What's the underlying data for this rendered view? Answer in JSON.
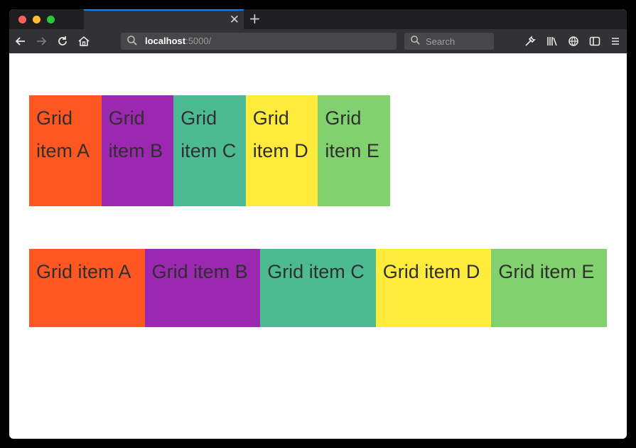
{
  "browser": {
    "tab_close_glyph": "✕",
    "new_tab_glyph": "+",
    "url_host": "localhost",
    "url_rest": ":5000/",
    "search_placeholder": "Search"
  },
  "icons": [
    "back-icon",
    "forward-icon",
    "reload-icon",
    "home-icon",
    "search-icon",
    "wrench-icon",
    "library-icon",
    "tracking-protection-icon",
    "sidebar-icon",
    "menu-icon"
  ],
  "colors": {
    "a": "#ff5722",
    "b": "#9c27b0",
    "c": "#4cbb94",
    "d": "#ffeb3b",
    "e": "#82d16f"
  },
  "grid1": {
    "items": [
      "Grid item A",
      "Grid item B",
      "Grid item C",
      "Grid item D",
      "Grid item E"
    ]
  },
  "grid2": {
    "items": [
      "Grid item A",
      "Grid item B",
      "Grid item C",
      "Grid item D",
      "Grid item E"
    ]
  }
}
